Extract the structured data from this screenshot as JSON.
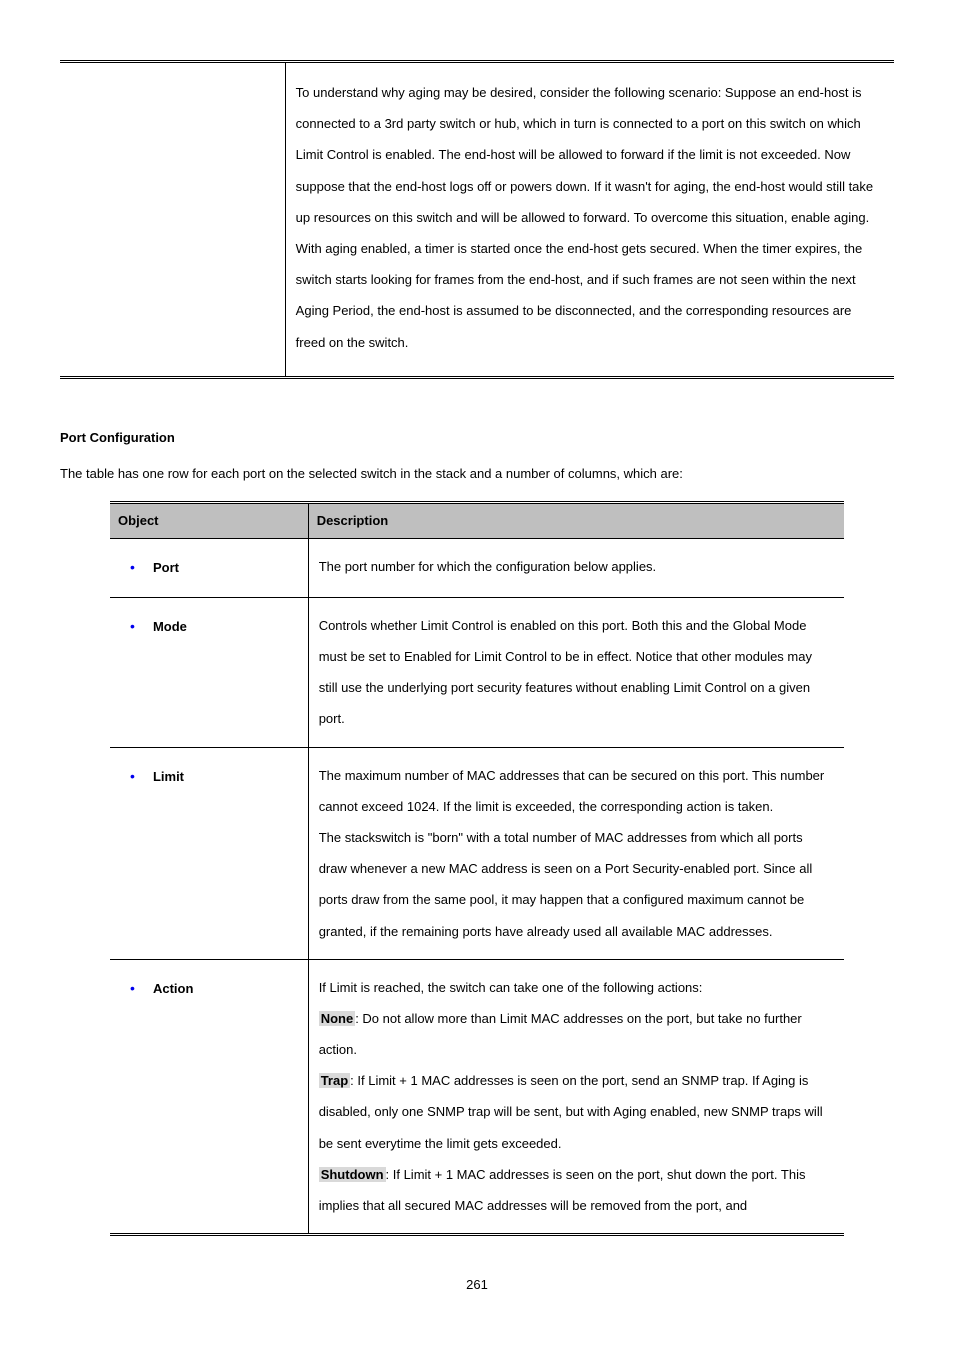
{
  "topTable": {
    "description": "To understand why aging may be desired, consider the following scenario: Suppose an end-host is connected to a 3rd party switch or hub, which in turn is connected to a port on this switch on which Limit Control is enabled. The end-host will be allowed to forward if the limit is not exceeded. Now suppose that the end-host logs off or powers down. If it wasn't for aging, the end-host would still take up resources on this switch and will be allowed to forward. To overcome this situation, enable aging. With aging enabled, a timer is started once the end-host gets secured. When the timer expires, the switch starts looking for frames from the end-host, and if such frames are not seen within the next Aging Period, the end-host is assumed to be disconnected, and the corresponding resources are freed on the switch."
  },
  "sectionHeading": "Port Configuration",
  "introText": "The table has one row for each port on the selected switch in the stack and a number of columns, which are:",
  "portTable": {
    "headers": {
      "col1": "Object",
      "col2": "Description"
    },
    "rows": {
      "r1": {
        "obj": "Port",
        "desc": "The port number for which the configuration below applies."
      },
      "r2": {
        "obj": "Mode",
        "desc": "Controls whether Limit Control is enabled on this port. Both this and the Global Mode must be set to Enabled for Limit Control to be in effect. Notice that other modules may still use the underlying port security features without enabling Limit Control on a given port."
      },
      "r3": {
        "obj": "Limit",
        "desc_p1": "The maximum number of MAC addresses that can be secured on this port. This number cannot exceed 1024. If the limit is exceeded, the corresponding action is taken.",
        "desc_p2": "The stackswitch is \"born\" with a total number of MAC addresses from which all ports draw whenever a new MAC address is seen on a Port Security-enabled port. Since all ports draw from the same pool, it may happen that a configured maximum cannot be granted, if the remaining ports have already used all available MAC addresses."
      },
      "r4": {
        "obj": "Action",
        "intro": "If Limit is reached, the switch can take one of the following actions:",
        "labelNone": "None",
        "noneText": ": Do not allow more than Limit MAC addresses on the port, but take no further action.",
        "labelTrap": "Trap",
        "trapText": ": If Limit + 1 MAC addresses is seen on the port, send an SNMP trap. If Aging is disabled, only one SNMP trap will be sent, but with Aging enabled, new SNMP traps will be sent everytime the limit gets exceeded.",
        "labelShutdown": "Shutdown",
        "shutdownText": ": If Limit + 1 MAC addresses is seen on the port, shut down the port. This implies that all secured MAC addresses will be removed from the port, and"
      }
    }
  },
  "pageNumber": "261"
}
